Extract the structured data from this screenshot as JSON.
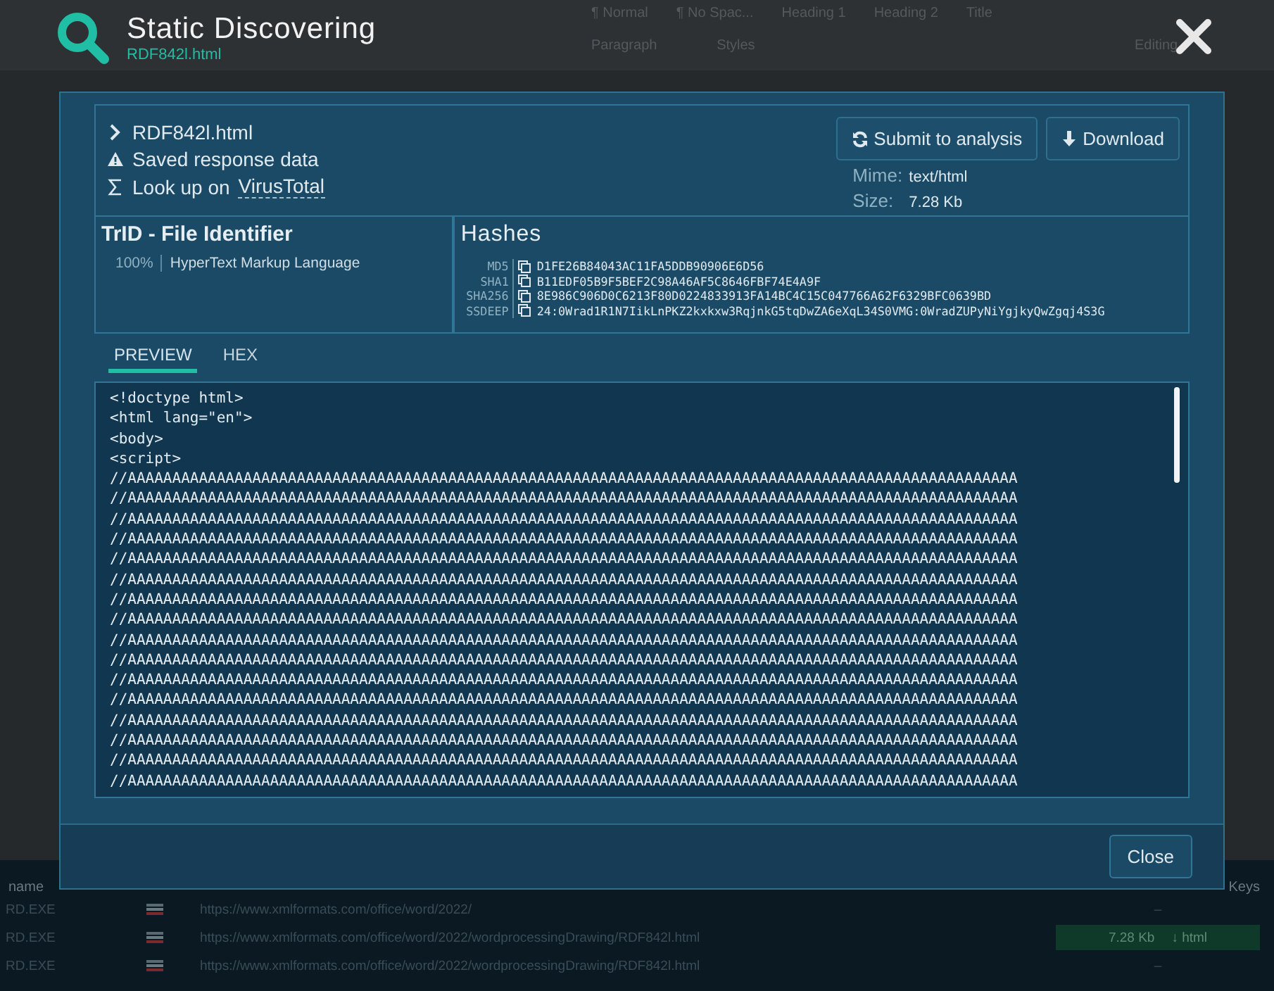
{
  "background": {
    "ribbon_styles": [
      "¶ Normal",
      "¶ No Spac...",
      "Heading 1",
      "Heading 2",
      "Title"
    ],
    "ribbon_groups": [
      "Paragraph",
      "Styles",
      "Editing"
    ],
    "table_headers": [
      "name",
      "Keys"
    ],
    "rows": [
      {
        "process": "RD.EXE",
        "url": "https://www.xmlformats.com/office/word/2022/",
        "size": "–",
        "selected": false
      },
      {
        "process": "RD.EXE",
        "url": "https://www.xmlformats.com/office/word/2022/wordprocessingDrawing/RDF842l.html",
        "size": "7.28 Kb",
        "type": "↓ html",
        "selected": true
      },
      {
        "process": "RD.EXE",
        "url": "https://www.xmlformats.com/office/word/2022/wordprocessingDrawing/RDF842l.html",
        "size": "–",
        "selected": false
      }
    ]
  },
  "dialog": {
    "title": "Static Discovering",
    "subtitle": "RDF842l.html",
    "file": {
      "name": "RDF842l.html",
      "saved": "Saved response data",
      "lookup_prefix": "Look up on",
      "lookup_link": "VirusTotal"
    },
    "actions": [
      "Submit to analysis",
      "Download"
    ],
    "mime": {
      "label": "Mime:",
      "value": "text/html"
    },
    "size": {
      "label": "Size:",
      "value": "7.28 Kb"
    },
    "trid": {
      "title": "TrID - File Identifier",
      "entries": [
        {
          "percent": "100%",
          "name": "HyperText Markup Language"
        }
      ]
    },
    "hashes": {
      "title": "Hashes",
      "rows": [
        {
          "label": "MD5",
          "value": "D1FE26B84043AC11FA5DDB90906E6D56"
        },
        {
          "label": "SHA1",
          "value": "B11EDF05B9F5BEF2C98A46AF5C8646FBF74E4A9F"
        },
        {
          "label": "SHA256",
          "value": "8E986C906D0C6213F80D0224833913FA14BC4C15C047766A62F6329BFC0639BD"
        },
        {
          "label": "SSDEEP",
          "value": "24:0Wrad1R1N7IikLnPKZ2kxkxw3RqjnkG5tqDwZA6eXqL34S0VMG:0WradZUPyNiYgjkyQwZgqj4S3G"
        }
      ]
    },
    "tabs": [
      {
        "label": "PREVIEW",
        "selected": true
      },
      {
        "label": "HEX",
        "selected": false
      }
    ],
    "preview_lines": [
      "<!doctype html>",
      "<html lang=\"en\">",
      "<body>",
      "<script>",
      "//AAAAAAAAAAAAAAAAAAAAAAAAAAAAAAAAAAAAAAAAAAAAAAAAAAAAAAAAAAAAAAAAAAAAAAAAAAAAAAAAAAAAAAAAAAAAAAAAAAAA",
      "//AAAAAAAAAAAAAAAAAAAAAAAAAAAAAAAAAAAAAAAAAAAAAAAAAAAAAAAAAAAAAAAAAAAAAAAAAAAAAAAAAAAAAAAAAAAAAAAAAAAA",
      "//AAAAAAAAAAAAAAAAAAAAAAAAAAAAAAAAAAAAAAAAAAAAAAAAAAAAAAAAAAAAAAAAAAAAAAAAAAAAAAAAAAAAAAAAAAAAAAAAAAAA",
      "//AAAAAAAAAAAAAAAAAAAAAAAAAAAAAAAAAAAAAAAAAAAAAAAAAAAAAAAAAAAAAAAAAAAAAAAAAAAAAAAAAAAAAAAAAAAAAAAAAAAA",
      "//AAAAAAAAAAAAAAAAAAAAAAAAAAAAAAAAAAAAAAAAAAAAAAAAAAAAAAAAAAAAAAAAAAAAAAAAAAAAAAAAAAAAAAAAAAAAAAAAAAAA",
      "//AAAAAAAAAAAAAAAAAAAAAAAAAAAAAAAAAAAAAAAAAAAAAAAAAAAAAAAAAAAAAAAAAAAAAAAAAAAAAAAAAAAAAAAAAAAAAAAAAAAA",
      "//AAAAAAAAAAAAAAAAAAAAAAAAAAAAAAAAAAAAAAAAAAAAAAAAAAAAAAAAAAAAAAAAAAAAAAAAAAAAAAAAAAAAAAAAAAAAAAAAAAAA",
      "//AAAAAAAAAAAAAAAAAAAAAAAAAAAAAAAAAAAAAAAAAAAAAAAAAAAAAAAAAAAAAAAAAAAAAAAAAAAAAAAAAAAAAAAAAAAAAAAAAAAA",
      "//AAAAAAAAAAAAAAAAAAAAAAAAAAAAAAAAAAAAAAAAAAAAAAAAAAAAAAAAAAAAAAAAAAAAAAAAAAAAAAAAAAAAAAAAAAAAAAAAAAAA",
      "//AAAAAAAAAAAAAAAAAAAAAAAAAAAAAAAAAAAAAAAAAAAAAAAAAAAAAAAAAAAAAAAAAAAAAAAAAAAAAAAAAAAAAAAAAAAAAAAAAAAA",
      "//AAAAAAAAAAAAAAAAAAAAAAAAAAAAAAAAAAAAAAAAAAAAAAAAAAAAAAAAAAAAAAAAAAAAAAAAAAAAAAAAAAAAAAAAAAAAAAAAAAAA",
      "//AAAAAAAAAAAAAAAAAAAAAAAAAAAAAAAAAAAAAAAAAAAAAAAAAAAAAAAAAAAAAAAAAAAAAAAAAAAAAAAAAAAAAAAAAAAAAAAAAAAA",
      "//AAAAAAAAAAAAAAAAAAAAAAAAAAAAAAAAAAAAAAAAAAAAAAAAAAAAAAAAAAAAAAAAAAAAAAAAAAAAAAAAAAAAAAAAAAAAAAAAAAAA",
      "//AAAAAAAAAAAAAAAAAAAAAAAAAAAAAAAAAAAAAAAAAAAAAAAAAAAAAAAAAAAAAAAAAAAAAAAAAAAAAAAAAAAAAAAAAAAAAAAAAAAA",
      "//AAAAAAAAAAAAAAAAAAAAAAAAAAAAAAAAAAAAAAAAAAAAAAAAAAAAAAAAAAAAAAAAAAAAAAAAAAAAAAAAAAAAAAAAAAAAAAAAAAAA",
      "//AAAAAAAAAAAAAAAAAAAAAAAAAAAAAAAAAAAAAAAAAAAAAAAAAAAAAAAAAAAAAAAAAAAAAAAAAAAAAAAAAAAAAAAAAAAAAAAAAAAA"
    ],
    "close": "Close"
  }
}
